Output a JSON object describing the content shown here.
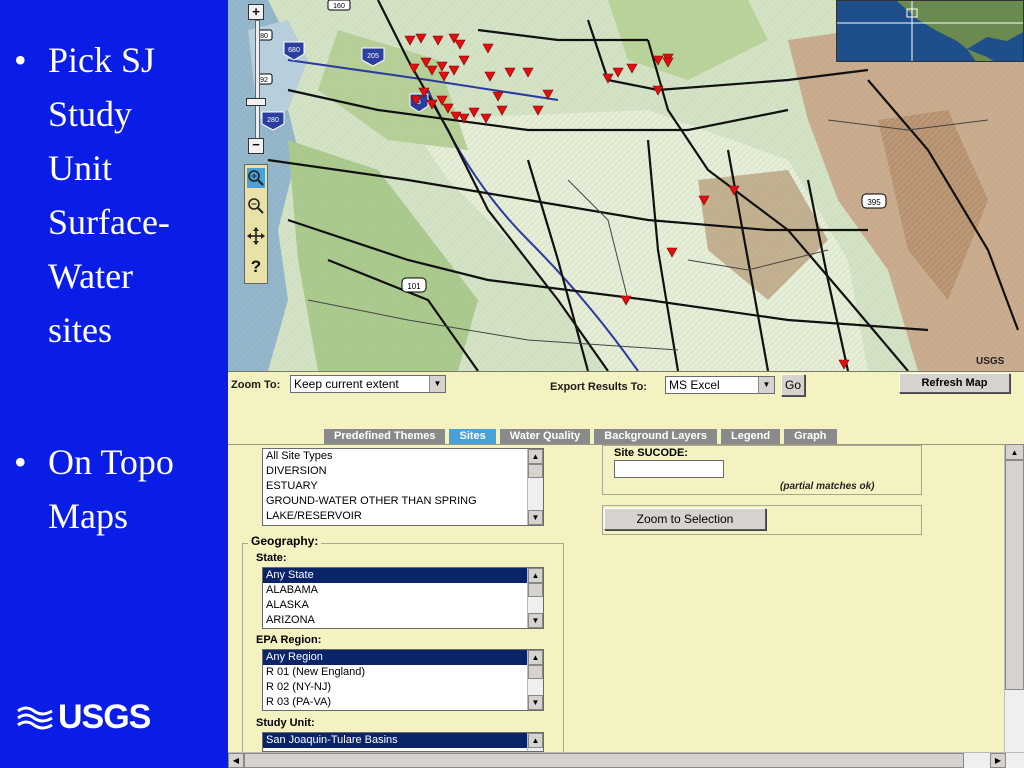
{
  "slide": {
    "bullets": [
      {
        "lines": [
          "Pick SJ",
          "Study",
          "Unit",
          "Surface-",
          "Water",
          "sites"
        ]
      },
      {
        "lines": [
          "On Topo",
          "Maps"
        ]
      }
    ],
    "logo_text": "USGS"
  },
  "map": {
    "route_shields": [
      "160",
      "680",
      "205",
      "5",
      "280",
      "101",
      "395",
      "80",
      "92"
    ],
    "map_watermark": "USGS",
    "site_marker_color": "#e01010"
  },
  "toolbar": {
    "zoom_to_label": "Zoom To:",
    "zoom_to_value": "Keep current extent",
    "export_label": "Export Results To:",
    "export_value": "MS Excel",
    "go_label": "Go",
    "refresh_label": "Refresh Map"
  },
  "tabs": [
    {
      "label": "Predefined Themes",
      "active": false
    },
    {
      "label": "Sites",
      "active": true
    },
    {
      "label": "Water Quality",
      "active": false
    },
    {
      "label": "Background Layers",
      "active": false
    },
    {
      "label": "Legend",
      "active": false
    },
    {
      "label": "Graph",
      "active": false
    }
  ],
  "site_types": {
    "items": [
      "All Site Types",
      "DIVERSION",
      "ESTUARY",
      "GROUND-WATER OTHER THAN SPRING",
      "LAKE/RESERVOIR"
    ]
  },
  "geography": {
    "legend": "Geography:",
    "state_label": "State:",
    "state_items": [
      "Any State",
      "ALABAMA",
      "ALASKA",
      "ARIZONA"
    ],
    "state_selected": "Any State",
    "epa_label": "EPA Region:",
    "epa_items": [
      "Any Region",
      "R 01 (New England)",
      "R 02 (NY-NJ)",
      "R 03 (PA-VA)"
    ],
    "epa_selected": "Any Region",
    "study_unit_label": "Study Unit:",
    "study_unit_items": [
      "San Joaquin-Tulare Basins"
    ],
    "study_unit_selected": "San Joaquin-Tulare Basins"
  },
  "sucode": {
    "label": "Site SUCODE:",
    "value": "",
    "hint": "(partial matches ok)"
  },
  "zoom_selection_label": "Zoom to Selection",
  "colors": {
    "slide_bg": "#0a1de6",
    "panel_bg": "#f4f2c0",
    "active_tab": "#4aa0d8",
    "inactive_tab": "#8a8a8a",
    "selection": "#0a246a"
  }
}
